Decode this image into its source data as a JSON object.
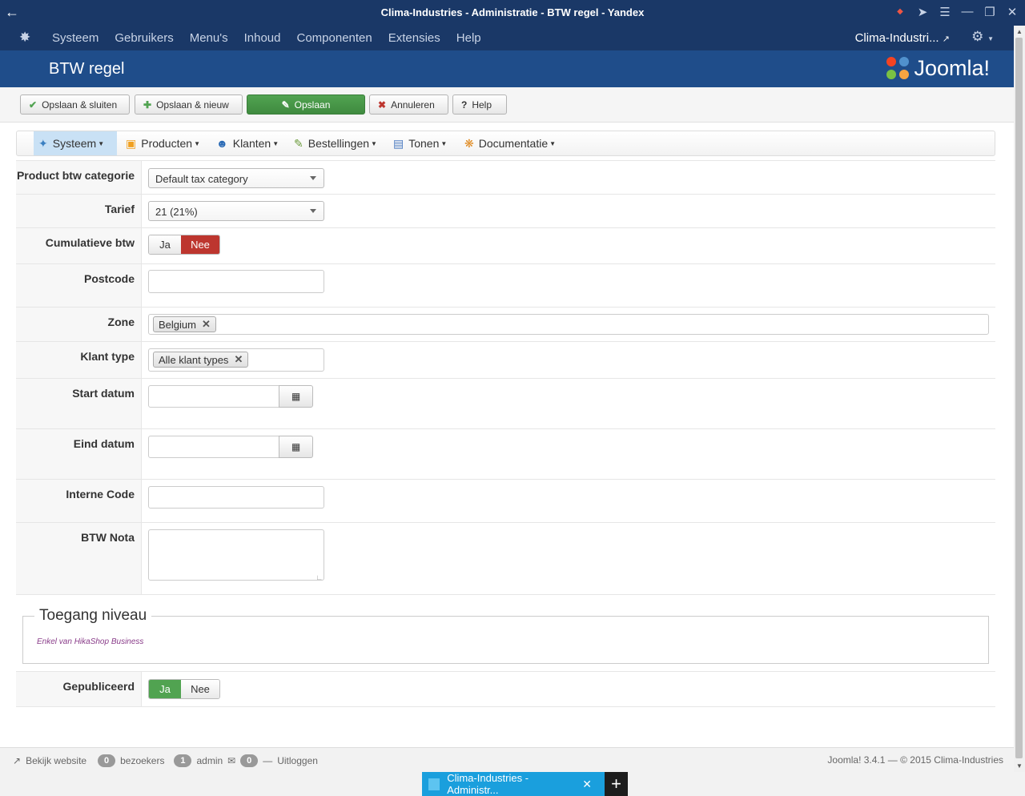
{
  "browser": {
    "window_title": "Clima-Industries - Administratie - BTW regel - Yandex"
  },
  "topmenu": {
    "items": [
      "Systeem",
      "Gebruikers",
      "Menu's",
      "Inhoud",
      "Componenten",
      "Extensies",
      "Help"
    ],
    "site_name": "Clima-Industri..."
  },
  "header": {
    "title": "BTW regel",
    "brand": "Joomla!"
  },
  "toolbar": {
    "save_close": "Opslaan & sluiten",
    "save_new": "Opslaan & nieuw",
    "save": "Opslaan",
    "cancel": "Annuleren",
    "help": "Help"
  },
  "submenu": {
    "items": [
      "Systeem",
      "Producten",
      "Klanten",
      "Bestellingen",
      "Tonen",
      "Documentatie"
    ]
  },
  "form": {
    "product_tax_category": {
      "label": "Product btw categorie",
      "value": "Default tax category"
    },
    "rate": {
      "label": "Tarief",
      "value": "21 (21%)"
    },
    "cumulative": {
      "label": "Cumulatieve btw",
      "yes": "Ja",
      "no": "Nee",
      "selected": "Nee"
    },
    "postcode": {
      "label": "Postcode",
      "value": ""
    },
    "zone": {
      "label": "Zone",
      "tags": [
        "Belgium"
      ]
    },
    "customer_type": {
      "label": "Klant type",
      "tags": [
        "Alle klant types"
      ]
    },
    "start_date": {
      "label": "Start datum",
      "value": ""
    },
    "end_date": {
      "label": "Eind datum",
      "value": ""
    },
    "internal_code": {
      "label": "Interne Code",
      "value": ""
    },
    "tax_note": {
      "label": "BTW Nota",
      "value": ""
    },
    "access": {
      "legend": "Toegang niveau",
      "note": "Enkel van HikaShop Business"
    },
    "published": {
      "label": "Gepubliceerd",
      "yes": "Ja",
      "no": "Nee",
      "selected": "Ja"
    }
  },
  "statusbar": {
    "view_site": "Bekijk website",
    "visitors_count": "0",
    "visitors_label": "bezoekers",
    "admin_count": "1",
    "admin_label": "admin",
    "messages_count": "0",
    "logout": "Uitloggen",
    "version": "Joomla! 3.4.1 — © 2015 Clima-Industries"
  },
  "taskbar": {
    "tab_title": "Clima-Industries - Administr..."
  },
  "colors": {
    "navbar": "#1a3867",
    "header": "#1f4d8a",
    "save_green": "#51a351",
    "no_red": "#bd362f",
    "task_blue": "#1a9fdd"
  }
}
